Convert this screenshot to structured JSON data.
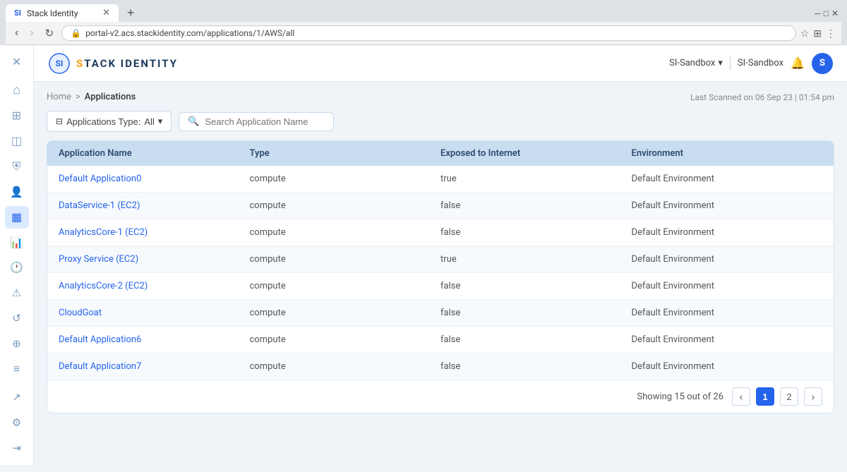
{
  "browser": {
    "tab_title": "Stack Identity",
    "tab_favicon": "SI",
    "url": "portal-v2.acs.stackidentity.com/applications/1/AWS/all",
    "new_tab_label": "+"
  },
  "header": {
    "logo_text_prefix": "Stack",
    "logo_text_suffix": " Identity",
    "env_label": "SI-Sandbox",
    "env_dropdown_icon": "▾",
    "notification_label": "SI-Sandbox",
    "avatar_initial": "S",
    "close_icon": "✕"
  },
  "breadcrumb": {
    "home": "Home",
    "separator": ">",
    "current": "Applications",
    "last_scanned": "Last Scanned on 06 Sep 23 | 01:54 pm"
  },
  "toolbar": {
    "filter_icon": "⊟",
    "filter_label": "Applications Type:",
    "filter_value": "All",
    "filter_dropdown": "▾",
    "search_placeholder": "Search Application Name",
    "search_icon": "🔍"
  },
  "table": {
    "columns": [
      "Application Name",
      "Type",
      "Exposed to Internet",
      "Environment"
    ],
    "rows": [
      {
        "name": "Default Application0",
        "type": "compute",
        "exposed": "true",
        "environment": "Default Environment"
      },
      {
        "name": "DataService-1 (EC2)",
        "type": "compute",
        "exposed": "false",
        "environment": "Default Environment"
      },
      {
        "name": "AnalyticsCore-1 (EC2)",
        "type": "compute",
        "exposed": "false",
        "environment": "Default Environment"
      },
      {
        "name": "Proxy Service (EC2)",
        "type": "compute",
        "exposed": "true",
        "environment": "Default Environment"
      },
      {
        "name": "AnalyticsCore-2 (EC2)",
        "type": "compute",
        "exposed": "false",
        "environment": "Default Environment"
      },
      {
        "name": "CloudGoat",
        "type": "compute",
        "exposed": "false",
        "environment": "Default Environment"
      },
      {
        "name": "Default Application6",
        "type": "compute",
        "exposed": "false",
        "environment": "Default Environment"
      },
      {
        "name": "Default Application7",
        "type": "compute",
        "exposed": "false",
        "environment": "Default Environment"
      }
    ]
  },
  "pagination": {
    "showing_text": "Showing 15 out of 26",
    "prev_icon": "‹",
    "next_icon": "›",
    "pages": [
      "1",
      "2"
    ],
    "active_page": "1"
  },
  "sidebar": {
    "icons": [
      {
        "name": "close-icon",
        "symbol": "✕",
        "interactable": true
      },
      {
        "name": "home-icon",
        "symbol": "⌂",
        "interactable": true
      },
      {
        "name": "grid-icon",
        "symbol": "⊞",
        "interactable": true
      },
      {
        "name": "layers-icon",
        "symbol": "◫",
        "interactable": true
      },
      {
        "name": "shield-icon",
        "symbol": "⛨",
        "interactable": true
      },
      {
        "name": "user-icon",
        "symbol": "👤",
        "interactable": true
      },
      {
        "name": "apps-active-icon",
        "symbol": "▦",
        "interactable": true,
        "active": true
      },
      {
        "name": "chart-icon",
        "symbol": "📊",
        "interactable": true
      },
      {
        "name": "clock-icon",
        "symbol": "🕐",
        "interactable": true
      },
      {
        "name": "alert-icon",
        "symbol": "⚠",
        "interactable": true
      },
      {
        "name": "history-icon",
        "symbol": "↺",
        "interactable": true
      },
      {
        "name": "tag-icon",
        "symbol": "⊕",
        "interactable": true
      },
      {
        "name": "bar-icon",
        "symbol": "≡",
        "interactable": true
      }
    ],
    "bottom_icons": [
      {
        "name": "share-icon",
        "symbol": "↗",
        "interactable": true
      },
      {
        "name": "settings-icon",
        "symbol": "⚙",
        "interactable": true
      },
      {
        "name": "logout-icon",
        "symbol": "⇥",
        "interactable": true
      }
    ]
  }
}
